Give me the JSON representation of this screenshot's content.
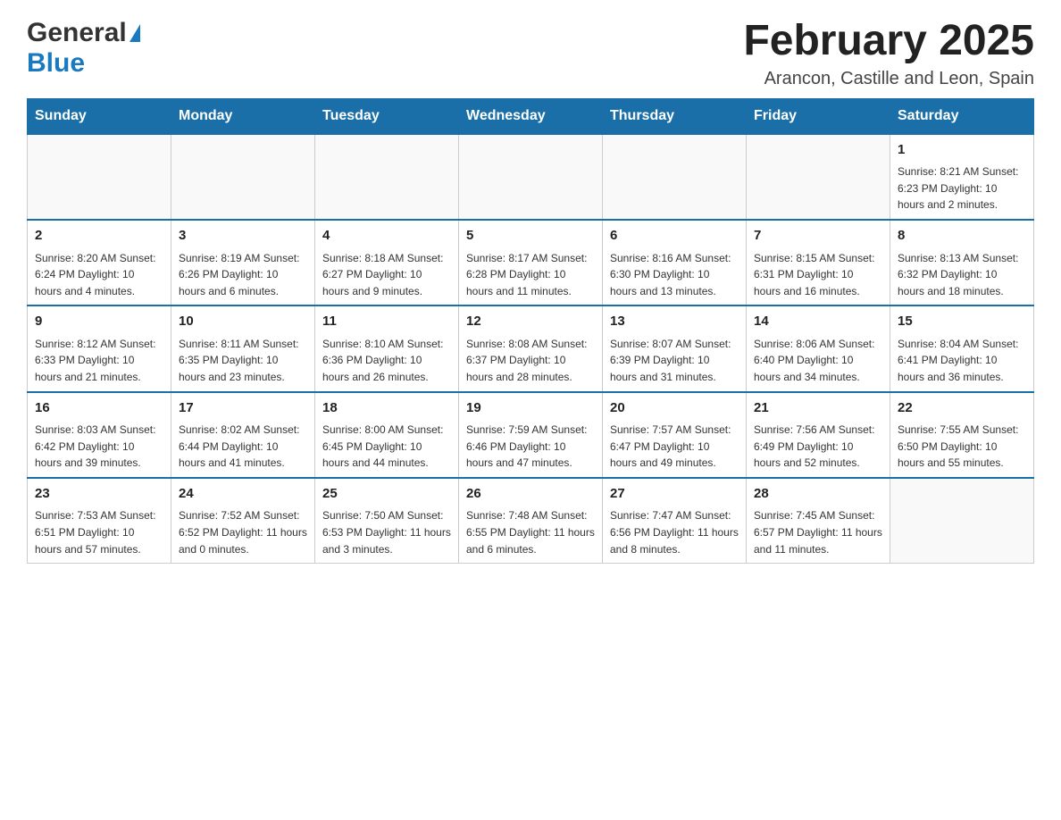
{
  "header": {
    "month_title": "February 2025",
    "location": "Arancon, Castille and Leon, Spain",
    "logo_general": "General",
    "logo_blue": "Blue"
  },
  "calendar": {
    "days_of_week": [
      "Sunday",
      "Monday",
      "Tuesday",
      "Wednesday",
      "Thursday",
      "Friday",
      "Saturday"
    ],
    "weeks": [
      [
        {
          "day": "",
          "info": ""
        },
        {
          "day": "",
          "info": ""
        },
        {
          "day": "",
          "info": ""
        },
        {
          "day": "",
          "info": ""
        },
        {
          "day": "",
          "info": ""
        },
        {
          "day": "",
          "info": ""
        },
        {
          "day": "1",
          "info": "Sunrise: 8:21 AM\nSunset: 6:23 PM\nDaylight: 10 hours\nand 2 minutes."
        }
      ],
      [
        {
          "day": "2",
          "info": "Sunrise: 8:20 AM\nSunset: 6:24 PM\nDaylight: 10 hours\nand 4 minutes."
        },
        {
          "day": "3",
          "info": "Sunrise: 8:19 AM\nSunset: 6:26 PM\nDaylight: 10 hours\nand 6 minutes."
        },
        {
          "day": "4",
          "info": "Sunrise: 8:18 AM\nSunset: 6:27 PM\nDaylight: 10 hours\nand 9 minutes."
        },
        {
          "day": "5",
          "info": "Sunrise: 8:17 AM\nSunset: 6:28 PM\nDaylight: 10 hours\nand 11 minutes."
        },
        {
          "day": "6",
          "info": "Sunrise: 8:16 AM\nSunset: 6:30 PM\nDaylight: 10 hours\nand 13 minutes."
        },
        {
          "day": "7",
          "info": "Sunrise: 8:15 AM\nSunset: 6:31 PM\nDaylight: 10 hours\nand 16 minutes."
        },
        {
          "day": "8",
          "info": "Sunrise: 8:13 AM\nSunset: 6:32 PM\nDaylight: 10 hours\nand 18 minutes."
        }
      ],
      [
        {
          "day": "9",
          "info": "Sunrise: 8:12 AM\nSunset: 6:33 PM\nDaylight: 10 hours\nand 21 minutes."
        },
        {
          "day": "10",
          "info": "Sunrise: 8:11 AM\nSunset: 6:35 PM\nDaylight: 10 hours\nand 23 minutes."
        },
        {
          "day": "11",
          "info": "Sunrise: 8:10 AM\nSunset: 6:36 PM\nDaylight: 10 hours\nand 26 minutes."
        },
        {
          "day": "12",
          "info": "Sunrise: 8:08 AM\nSunset: 6:37 PM\nDaylight: 10 hours\nand 28 minutes."
        },
        {
          "day": "13",
          "info": "Sunrise: 8:07 AM\nSunset: 6:39 PM\nDaylight: 10 hours\nand 31 minutes."
        },
        {
          "day": "14",
          "info": "Sunrise: 8:06 AM\nSunset: 6:40 PM\nDaylight: 10 hours\nand 34 minutes."
        },
        {
          "day": "15",
          "info": "Sunrise: 8:04 AM\nSunset: 6:41 PM\nDaylight: 10 hours\nand 36 minutes."
        }
      ],
      [
        {
          "day": "16",
          "info": "Sunrise: 8:03 AM\nSunset: 6:42 PM\nDaylight: 10 hours\nand 39 minutes."
        },
        {
          "day": "17",
          "info": "Sunrise: 8:02 AM\nSunset: 6:44 PM\nDaylight: 10 hours\nand 41 minutes."
        },
        {
          "day": "18",
          "info": "Sunrise: 8:00 AM\nSunset: 6:45 PM\nDaylight: 10 hours\nand 44 minutes."
        },
        {
          "day": "19",
          "info": "Sunrise: 7:59 AM\nSunset: 6:46 PM\nDaylight: 10 hours\nand 47 minutes."
        },
        {
          "day": "20",
          "info": "Sunrise: 7:57 AM\nSunset: 6:47 PM\nDaylight: 10 hours\nand 49 minutes."
        },
        {
          "day": "21",
          "info": "Sunrise: 7:56 AM\nSunset: 6:49 PM\nDaylight: 10 hours\nand 52 minutes."
        },
        {
          "day": "22",
          "info": "Sunrise: 7:55 AM\nSunset: 6:50 PM\nDaylight: 10 hours\nand 55 minutes."
        }
      ],
      [
        {
          "day": "23",
          "info": "Sunrise: 7:53 AM\nSunset: 6:51 PM\nDaylight: 10 hours\nand 57 minutes."
        },
        {
          "day": "24",
          "info": "Sunrise: 7:52 AM\nSunset: 6:52 PM\nDaylight: 11 hours\nand 0 minutes."
        },
        {
          "day": "25",
          "info": "Sunrise: 7:50 AM\nSunset: 6:53 PM\nDaylight: 11 hours\nand 3 minutes."
        },
        {
          "day": "26",
          "info": "Sunrise: 7:48 AM\nSunset: 6:55 PM\nDaylight: 11 hours\nand 6 minutes."
        },
        {
          "day": "27",
          "info": "Sunrise: 7:47 AM\nSunset: 6:56 PM\nDaylight: 11 hours\nand 8 minutes."
        },
        {
          "day": "28",
          "info": "Sunrise: 7:45 AM\nSunset: 6:57 PM\nDaylight: 11 hours\nand 11 minutes."
        },
        {
          "day": "",
          "info": ""
        }
      ]
    ]
  }
}
